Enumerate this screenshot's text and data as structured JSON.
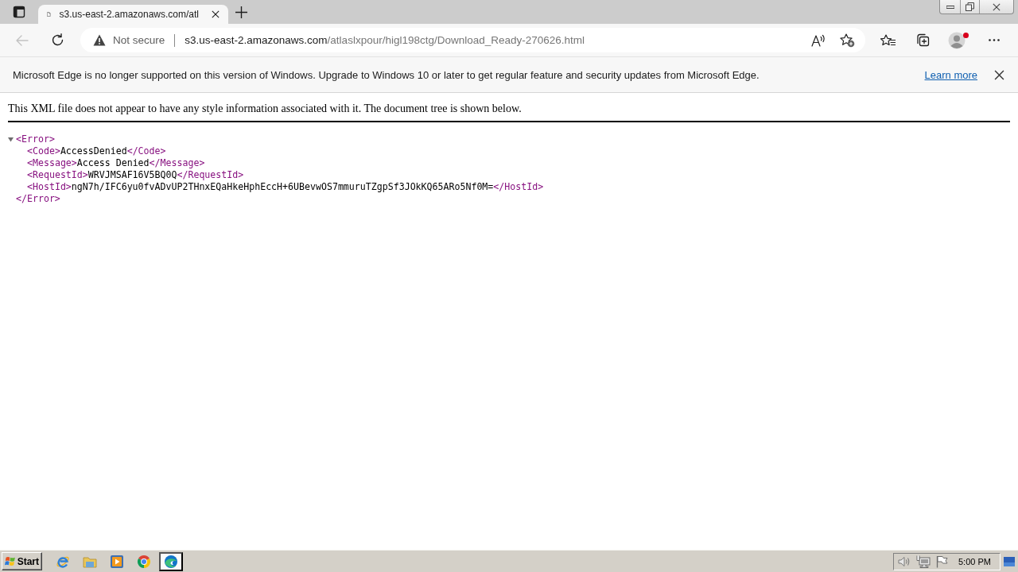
{
  "tab_strip": {
    "tabs": [
      {
        "title": "s3.us-east-2.amazonaws.com/atl",
        "selected": true
      }
    ]
  },
  "navigation": {
    "back": {
      "disabled": true
    }
  },
  "address_bar": {
    "security_label": "Not secure",
    "url_host": "s3.us-east-2.amazonaws.com",
    "url_path": "/atlaslxpour/higl198ctg/Download_Ready-270626.html"
  },
  "profile": {
    "notification": true
  },
  "info_bar": {
    "message": "Microsoft Edge is no longer supported on this version of Windows. Upgrade to Windows 10 or later to get regular feature and security updates from Microsoft Edge.",
    "link": "Learn more"
  },
  "document": {
    "notice": "This XML file does not appear to have any style information associated with it. The document tree is shown below.",
    "xml_tree": {
      "open_tag": "<Error>",
      "close_tag": "</Error>",
      "expanded": true,
      "children": [
        {
          "open_tag": "<Code>",
          "value": "AccessDenied",
          "close_tag": "</Code>"
        },
        {
          "open_tag": "<Message>",
          "value": "Access Denied",
          "close_tag": "</Message>"
        },
        {
          "open_tag": "<RequestId>",
          "value": "WRVJMSAF16V5BQ0Q",
          "close_tag": "</RequestId>"
        },
        {
          "open_tag": "<HostId>",
          "value": "ngN7h/IFC6yu0fvADvUP2THnxEQaHkeHphEccH+6UBevwOS7mmuruTZgpSf3JOkKQ65ARo5Nf0M=",
          "close_tag": "</HostId>"
        }
      ]
    }
  },
  "taskbar": {
    "start_label": "Start",
    "apps": [
      {
        "kind": "ie",
        "selected": false
      },
      {
        "kind": "folder",
        "selected": false
      },
      {
        "kind": "media",
        "selected": false
      },
      {
        "kind": "chrome",
        "selected": false
      },
      {
        "kind": "edge",
        "selected": true
      }
    ],
    "clock": "5:00 PM"
  }
}
